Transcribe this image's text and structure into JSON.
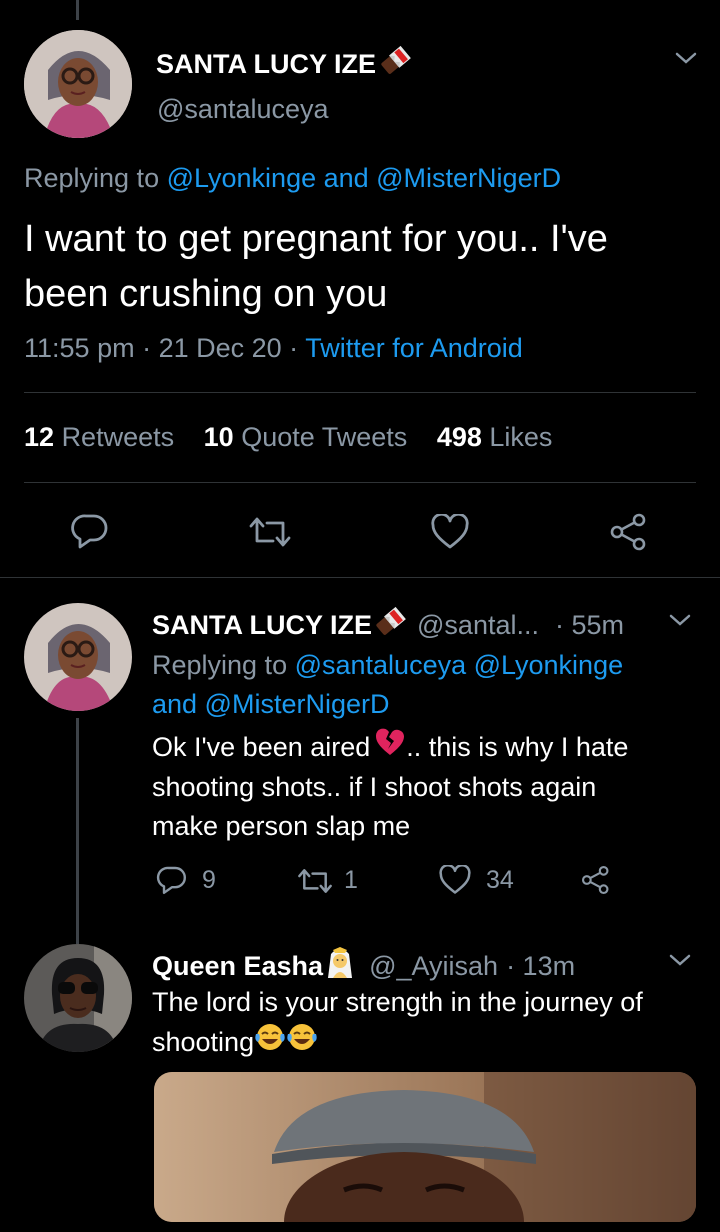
{
  "main_tweet": {
    "author_name": "SANTA LUCY IZE",
    "handle": "@santaluceya",
    "replying_prefix": "Replying to ",
    "replying_to": "@Lyonkinge and @MisterNigerD",
    "text_line1": "I want to get pregnant for you.. I've",
    "text_line2": "been crushing on you",
    "time": "11:55 pm",
    "sep": " · ",
    "date": "21 Dec 20",
    "source": "Twitter for Android",
    "retweets_count": "12",
    "retweets_label": "Retweets",
    "quotes_count": "10",
    "quotes_label": "Quote Tweets",
    "likes_count": "498",
    "likes_label": "Likes"
  },
  "reply1": {
    "author_name": "SANTA LUCY IZE",
    "handle": "@santal...",
    "time": "· 55m",
    "replying_prefix": "Replying to ",
    "replying_line1": "@santaluceya @Lyonkinge",
    "replying_line2": "and @MisterNigerD",
    "text_line1_a": "Ok I've been aired ",
    "text_line1_b": ".. this is why I hate",
    "text_line2": "shooting shots.. if I shoot shots again",
    "text_line3": "make person slap me",
    "reply_count": "9",
    "retweet_count": "1",
    "like_count": "34"
  },
  "reply2": {
    "author_name": "Queen Easha",
    "handle": "@_Ayiisah",
    "time": "· 13m",
    "text_line1": "The lord is your strength in the journey of",
    "text_line2": "shooting "
  },
  "icons": {
    "reply": "reply-icon",
    "retweet": "retweet-icon",
    "like": "heart-icon",
    "share": "share-icon",
    "chevron": "chevron-down-icon",
    "chocolate": "chocolate-emoji",
    "broken_heart": "broken-heart-emoji",
    "crying_laugh": "tears-of-joy-emoji",
    "bride": "person-with-veil-emoji"
  },
  "colors": {
    "background": "#000000",
    "link": "#1d9bf0",
    "muted": "#8b98a5",
    "divider": "#2f3336"
  }
}
